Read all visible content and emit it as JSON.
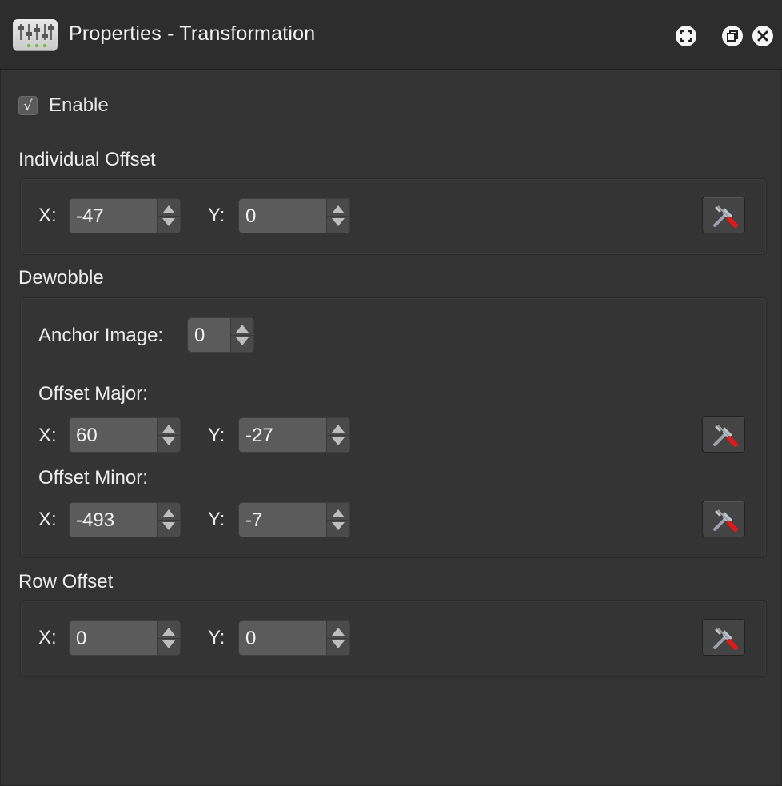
{
  "window": {
    "title": "Properties - Transformation"
  },
  "icons": {
    "app": "sliders-icon",
    "fullscreen": "fullscreen-icon",
    "restore": "restore-window-icon",
    "close": "close-icon",
    "tool": "tools-icon"
  },
  "enable": {
    "label": "Enable",
    "checked": true,
    "check_glyph": "√"
  },
  "individual_offset": {
    "title": "Individual Offset",
    "x_label": "X:",
    "x_value": "-47",
    "y_label": "Y:",
    "y_value": "0"
  },
  "dewobble": {
    "title": "Dewobble",
    "anchor_label": "Anchor Image:",
    "anchor_value": "0",
    "major_label": "Offset Major:",
    "major_x_label": "X:",
    "major_x_value": "60",
    "major_y_label": "Y:",
    "major_y_value": "-27",
    "minor_label": "Offset Minor:",
    "minor_x_label": "X:",
    "minor_x_value": "-493",
    "minor_y_label": "Y:",
    "minor_y_value": "-7"
  },
  "row_offset": {
    "title": "Row Offset",
    "x_label": "X:",
    "x_value": "0",
    "y_label": "Y:",
    "y_value": "0"
  },
  "colors": {
    "background": "#333333",
    "titlebar": "#2d2d2d",
    "field": "#5b5b5b",
    "text": "#ececec"
  }
}
